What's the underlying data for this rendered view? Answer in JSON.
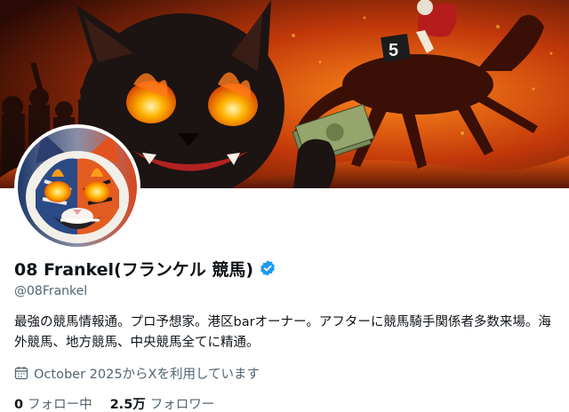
{
  "profile": {
    "display_name": "08 Frankel(フランケル 競馬)",
    "handle": "@08Frankel",
    "bio": "最強の競馬情報通。プロ予想家。港区barオーナー。アフターに競馬騎手関係者多数来場。海外競馬、地方競馬、中央競馬全てに精通。",
    "joined": "October 2025からXを利用しています",
    "verified": true,
    "verified_color": "#1d9bf0"
  },
  "stats": {
    "following_count": "0",
    "following_label": "フォロー中",
    "followers_count": "2.5万",
    "followers_label": "フォロワー"
  },
  "banner": {
    "horse_number": "5"
  },
  "icons": {
    "verified": "verified-badge-icon",
    "joined": "calendar-icon"
  }
}
